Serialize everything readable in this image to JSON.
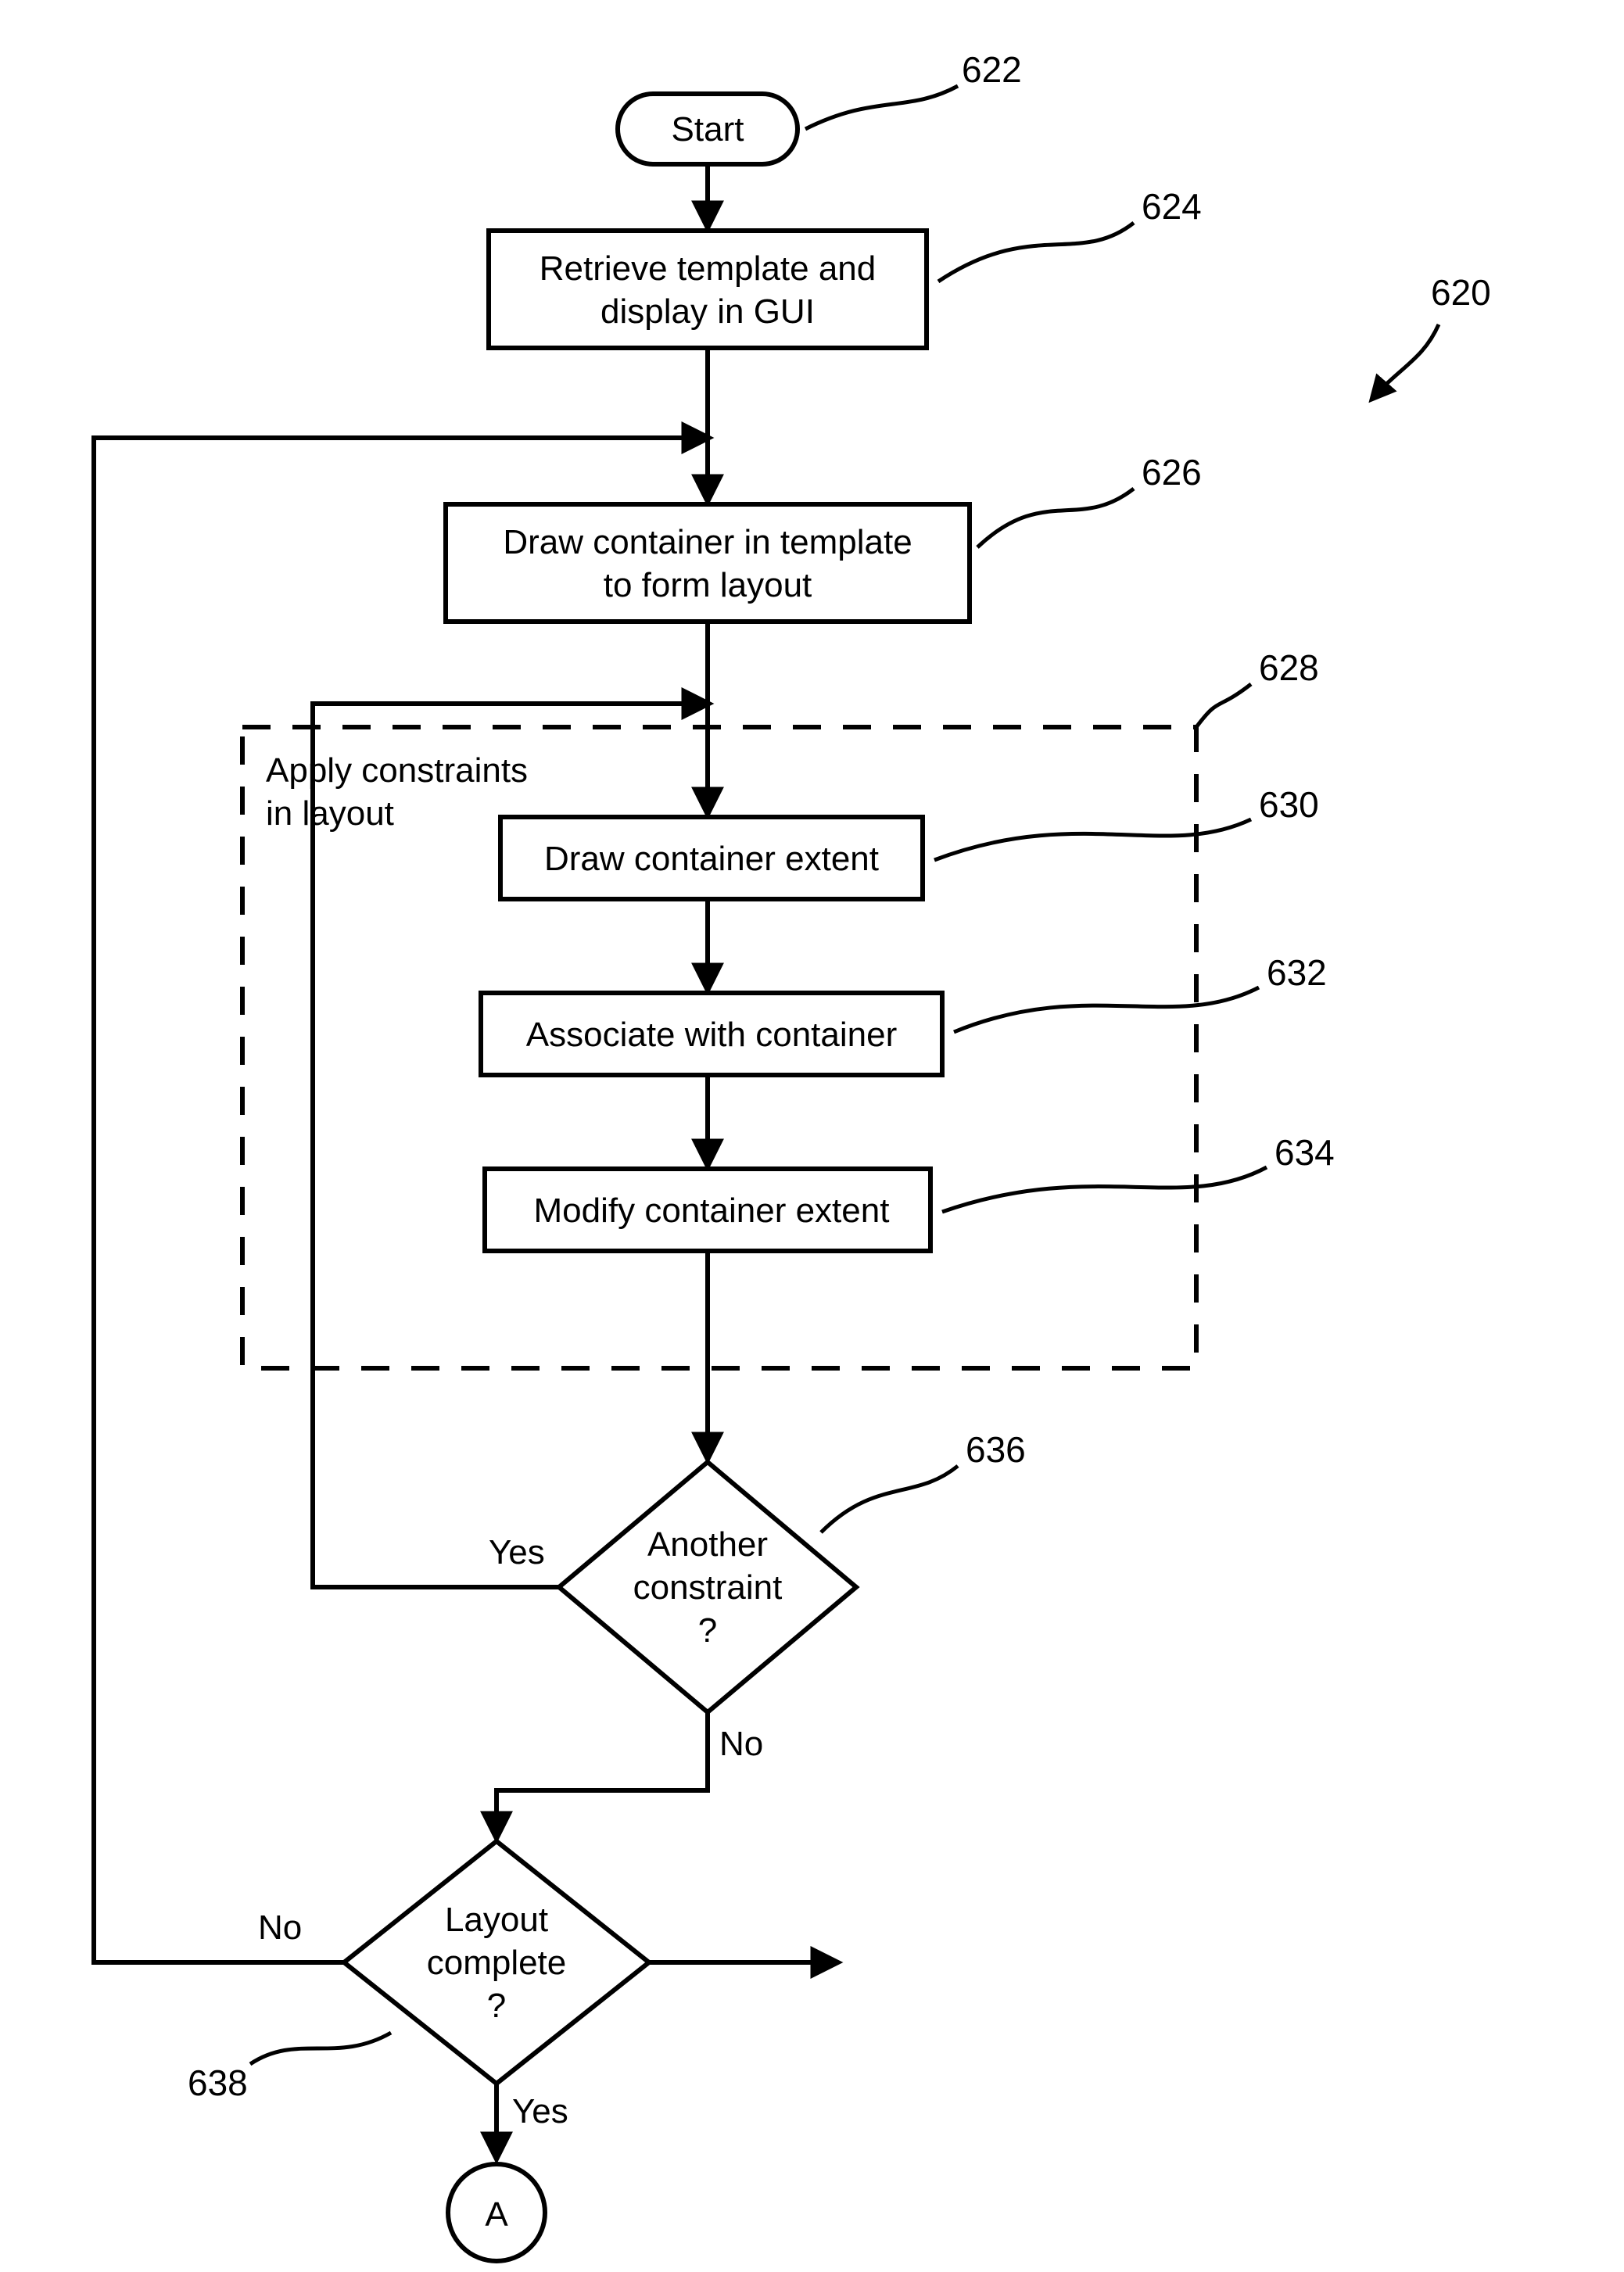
{
  "refs": {
    "fig": "620",
    "start": "622",
    "retrieve": "624",
    "draw_container": "626",
    "constraints_group": "628",
    "draw_extent": "630",
    "associate": "632",
    "modify_extent": "634",
    "another_constraint": "636",
    "layout_complete": "638"
  },
  "labels": {
    "start": "Start",
    "retrieve_l1": "Retrieve template and",
    "retrieve_l2": "display in GUI",
    "draw_container_l1": "Draw container in template",
    "draw_container_l2": "to form layout",
    "constraints_l1": "Apply constraints",
    "constraints_l2": "in layout",
    "draw_extent": "Draw container extent",
    "associate": "Associate with container",
    "modify_extent": "Modify container extent",
    "another_l1": "Another",
    "another_l2": "constraint",
    "another_l3": "?",
    "layout_l1": "Layout",
    "layout_l2": "complete",
    "layout_l3": "?",
    "yes": "Yes",
    "no": "No",
    "connector": "A"
  }
}
